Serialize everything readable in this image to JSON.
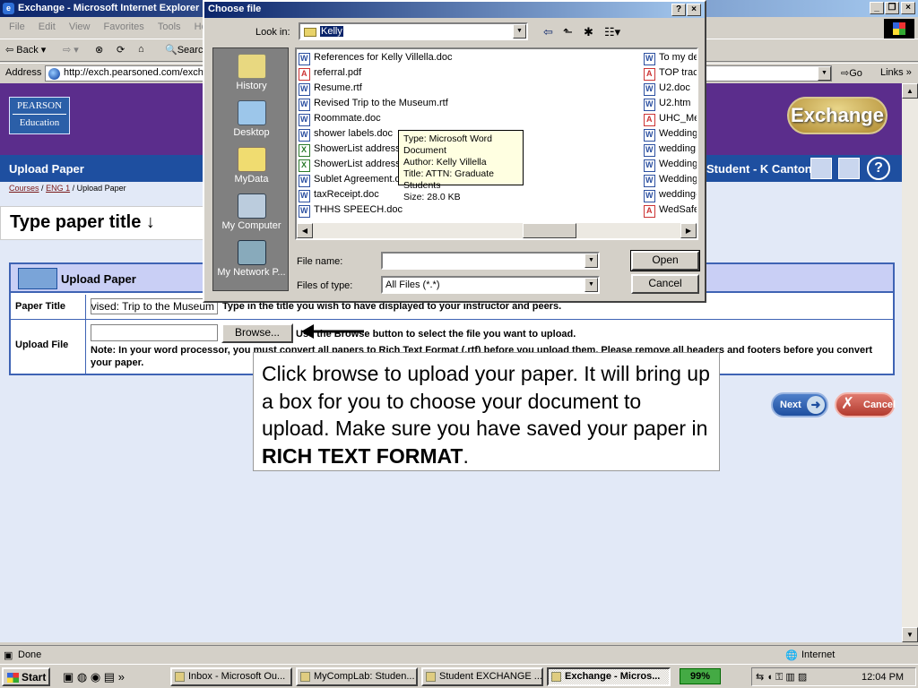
{
  "window": {
    "title": "Exchange - Microsoft Internet Explorer",
    "menu": [
      "File",
      "Edit",
      "View",
      "Favorites",
      "Tools",
      "Help"
    ],
    "toolbar": {
      "back": "Back",
      "search": "Search"
    },
    "address_label": "Address",
    "address_url": "http://exch.pearsoned.com/exchange/uploadpaper",
    "go_label": "Go",
    "links_label": "Links"
  },
  "page": {
    "brand_line1": "PEARSON",
    "brand_line2": "Education",
    "exchange_logo": "Exchange",
    "section_title": "Upload Paper",
    "student": "Student - K Canton",
    "breadcrumb": {
      "courses": "Courses",
      "course": "ENG 1",
      "current": "Upload Paper",
      "sep": "/"
    },
    "callout_title": "Type paper title ↓",
    "form": {
      "heading": "Upload Paper",
      "paper_title_label": "Paper Title",
      "paper_title_value": "Revised: Trip to the Museum",
      "paper_title_hint": "Type in the title you wish to have displayed to your instructor and peers.",
      "upload_label": "Upload File",
      "browse_label": "Browse...",
      "upload_hint": "Use the Browse button to select the file you want to upload.",
      "note": "Note: In your word processor, you must convert all papers to Rich Text Format (.rtf) before you upload them. Please remove all headers and footers before you convert your paper."
    },
    "browse_callout": {
      "text": "Click browse to upload your paper.  It will bring up a box for you to choose your document to upload.  Make sure you have saved your paper in ",
      "bold": "RICH TEXT FORMAT",
      "end": "."
    },
    "next_label": "Next",
    "cancel_label": "Cancel"
  },
  "dialog": {
    "title": "Choose file",
    "look_in_label": "Look in:",
    "look_in_value": "Kelly",
    "places": [
      "History",
      "Desktop",
      "MyData",
      "My Computer",
      "My Network P..."
    ],
    "files_col1": [
      {
        "name": "References for Kelly Villella.doc",
        "type": "doc"
      },
      {
        "name": "referral.pdf",
        "type": "pdf"
      },
      {
        "name": "Resume.rtf",
        "type": "doc"
      },
      {
        "name": "Revised Trip to the Museum.rtf",
        "type": "doc"
      },
      {
        "name": "Roommate.doc",
        "type": "doc"
      },
      {
        "name": "shower labels.doc",
        "type": "doc"
      },
      {
        "name": "ShowerList addresse",
        "type": "xls"
      },
      {
        "name": "ShowerList addresse",
        "type": "xls"
      },
      {
        "name": "Sublet Agreement.d",
        "type": "doc"
      },
      {
        "name": "taxReceipt.doc",
        "type": "doc"
      },
      {
        "name": "THHS SPEECH.doc",
        "type": "doc"
      }
    ],
    "files_col2": [
      {
        "name": "To my de",
        "type": "doc"
      },
      {
        "name": "TOP trac",
        "type": "pdf"
      },
      {
        "name": "U2.doc",
        "type": "doc"
      },
      {
        "name": "U2.htm",
        "type": "doc"
      },
      {
        "name": "UHC_Me",
        "type": "pdf"
      },
      {
        "name": "Wedding",
        "type": "doc"
      },
      {
        "name": "wedding",
        "type": "doc"
      },
      {
        "name": "Wedding",
        "type": "doc"
      },
      {
        "name": "Wedding",
        "type": "doc"
      },
      {
        "name": "wedding-",
        "type": "doc"
      },
      {
        "name": "WedSafe",
        "type": "pdf"
      }
    ],
    "tooltip": [
      "Type: Microsoft Word Document",
      "Author: Kelly Villella",
      "Title: ATTN: Graduate Students",
      "Size: 28.0 KB"
    ],
    "file_name_label": "File name:",
    "file_name_value": "",
    "files_of_type_label": "Files of type:",
    "files_of_type_value": "All Files (*.*)",
    "open_label": "Open",
    "cancel_label": "Cancel"
  },
  "status": {
    "text": "Done",
    "zone": "Internet"
  },
  "taskbar": {
    "start": "Start",
    "tasks": [
      {
        "label": "Inbox - Microsoft Ou...",
        "active": false
      },
      {
        "label": "MyCompLab: Studen...",
        "active": false
      },
      {
        "label": "Student EXCHANGE ...",
        "active": false
      },
      {
        "label": "Exchange - Micros...",
        "active": true
      }
    ],
    "battery": "99%",
    "clock": "12:04 PM"
  }
}
